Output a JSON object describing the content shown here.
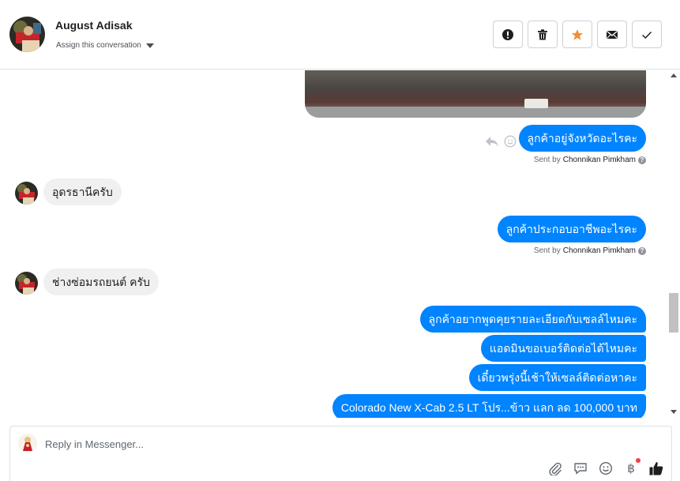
{
  "header": {
    "contact_name": "August Adisak",
    "assign_label": "Assign this conversation",
    "actions": [
      "mark-spam-icon",
      "trash-icon",
      "star-icon",
      "envelope-icon",
      "checkmark-icon"
    ],
    "star_color": "#f38d35"
  },
  "messages": [
    {
      "dir": "out",
      "text": "ลูกค้าอยู่จังหวัดอะไรคะ",
      "sent_by_prefix": "Sent by",
      "agent": "Chonnikan Pimkham"
    },
    {
      "dir": "in",
      "text": "อุดรธานีครับ"
    },
    {
      "dir": "out",
      "text": "ลูกค้าประกอบอาชีพอะไรคะ",
      "sent_by_prefix": "Sent by",
      "agent": "Chonnikan Pimkham"
    },
    {
      "dir": "in",
      "text": "ช่างซ่อมรถยนต์ ครับ"
    },
    {
      "dir": "out",
      "text": "ลูกค้าอยากพูดคุยรายละเอียดกับเซลล์ไหมคะ"
    },
    {
      "dir": "out",
      "text": "แอดมินขอเบอร์ติดต่อได้ไหมคะ"
    },
    {
      "dir": "out",
      "text": "เดี๋ยวพรุ่งนี้เช้าให้เซลล์ติดต่อหาคะ"
    },
    {
      "dir": "out",
      "text": "Colorado New X-Cab 2.5 LT โปร...ข้าว แลก ลด 100,000 บาท"
    }
  ],
  "composer": {
    "placeholder": "Reply in Messenger...",
    "tools": [
      "paperclip-icon",
      "chat-bubble-icon",
      "emoji-icon",
      "baht-icon",
      "thumbs-up-icon"
    ],
    "baht_symbol": "฿"
  },
  "colors": {
    "outgoing_bubble": "#0084ff",
    "incoming_bubble": "#f1f0f0",
    "badge": "#fa3e3e"
  }
}
